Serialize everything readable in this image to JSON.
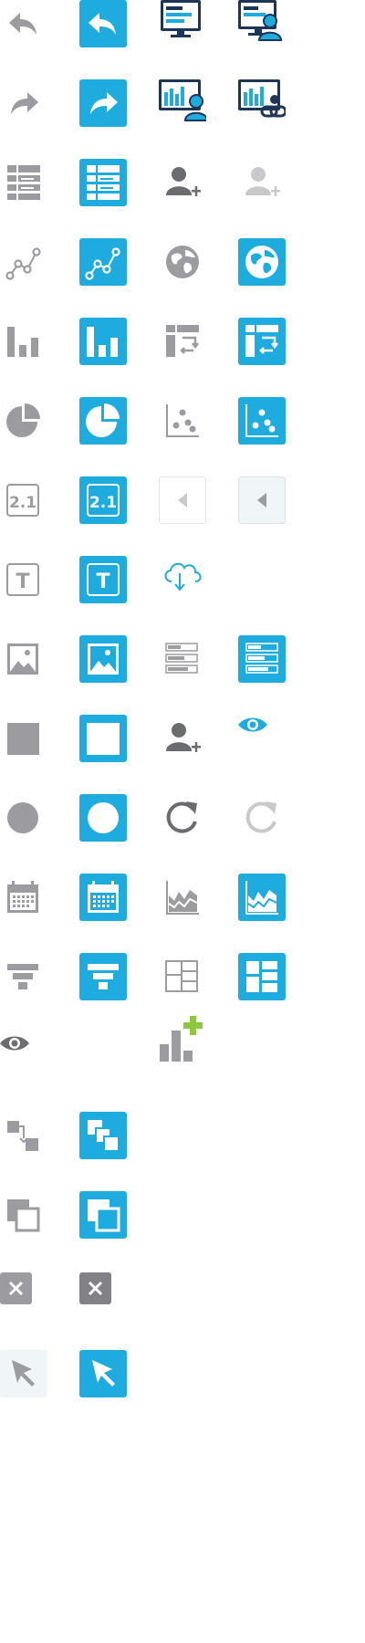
{
  "colors": {
    "accent": "#1eabdd",
    "gray": "#9b9ba0",
    "dark_gray": "#6b6c70",
    "light_gray": "#c9c9cc",
    "navy": "#1d3557",
    "green": "#8dc63f",
    "white": "#ffffff",
    "pale_bg": "#f0f5f8"
  },
  "icons": {
    "number_value": "2.1",
    "text_letter": "T"
  }
}
